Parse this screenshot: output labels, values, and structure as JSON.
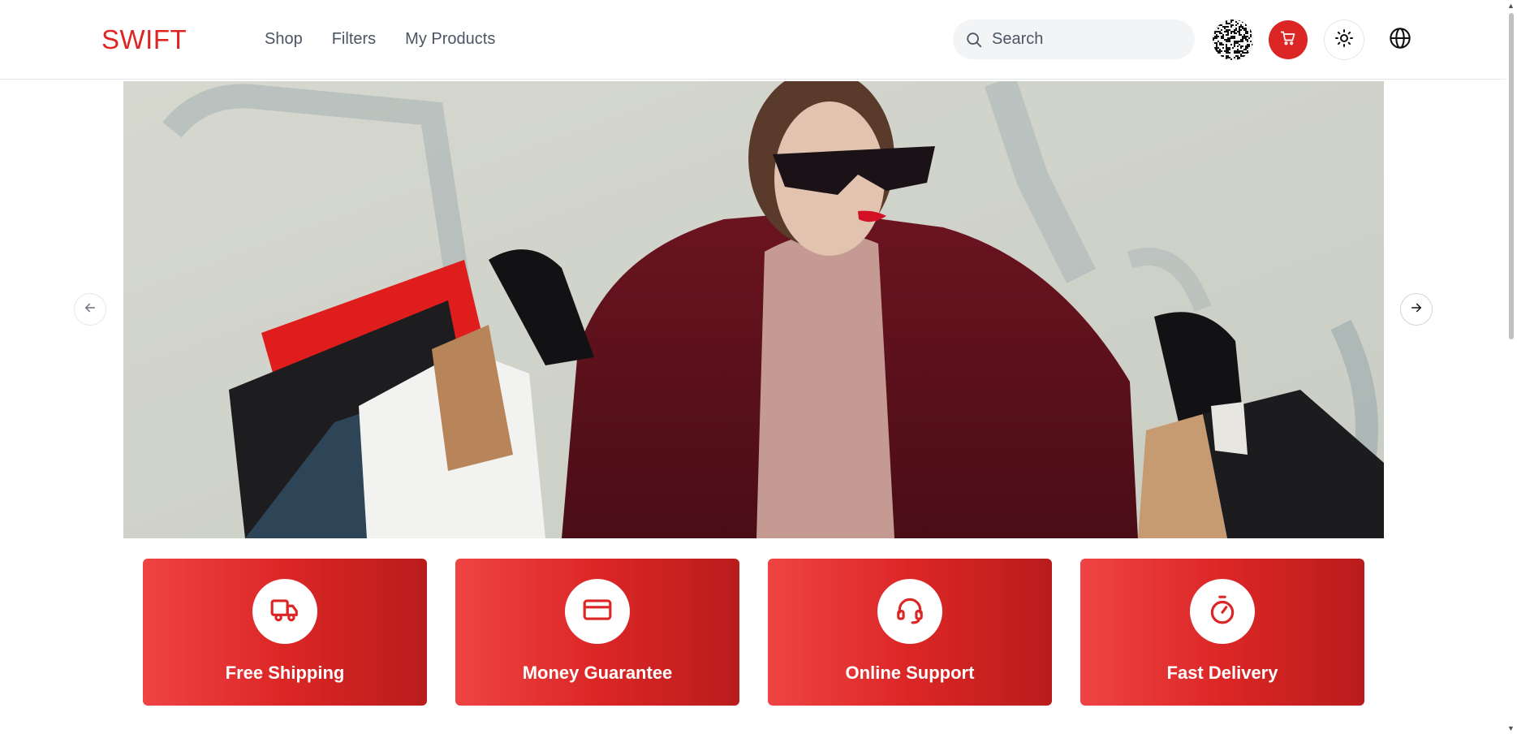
{
  "header": {
    "logo": "SWIFT",
    "nav": [
      {
        "label": "Shop"
      },
      {
        "label": "Filters"
      },
      {
        "label": "My Products"
      }
    ],
    "search": {
      "placeholder": "Search",
      "value": ""
    }
  },
  "features": [
    {
      "label": "Free Shipping",
      "icon": "truck-icon"
    },
    {
      "label": "Money Guarantee",
      "icon": "credit-card-icon"
    },
    {
      "label": "Online Support",
      "icon": "headset-icon"
    },
    {
      "label": "Fast Delivery",
      "icon": "stopwatch-icon"
    }
  ],
  "colors": {
    "accent": "#dc2626",
    "feature_gradient_start": "#ef4444",
    "feature_gradient_end": "#b91c1c"
  }
}
